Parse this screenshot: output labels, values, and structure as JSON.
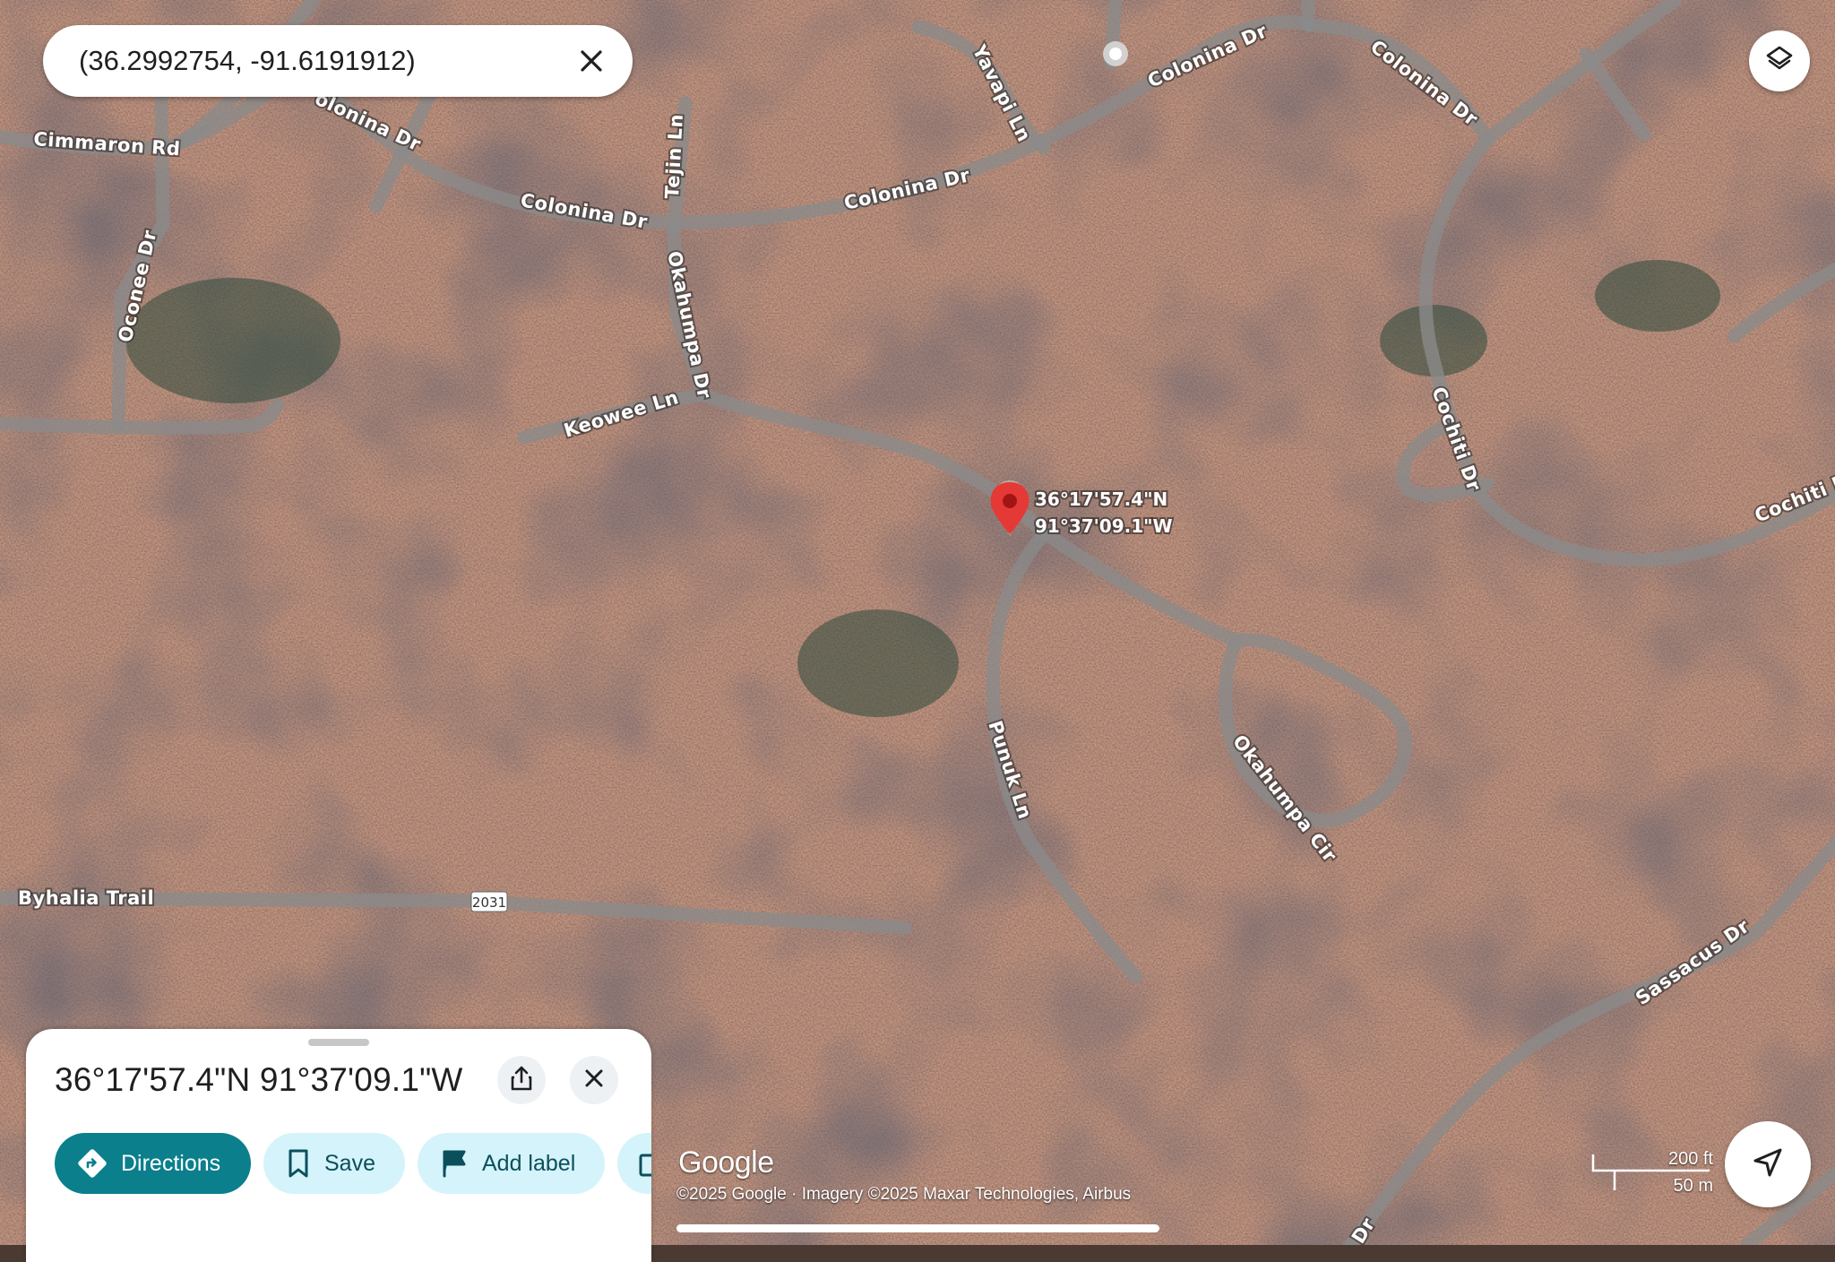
{
  "search": {
    "query": "(36.2992754, -91.6191912)"
  },
  "pin": {
    "lat_label": "36°17'57.4\"N",
    "lng_label": "91°37'09.1\"W"
  },
  "roads": {
    "cimmaron": "Cimmaron Rd",
    "colonina_a": "olonina Dr",
    "colonina_b": "Colonina Dr",
    "colonina_c": "Colonina Dr",
    "colonina_d": "Colonina Dr",
    "colonina_e": "Colonina Dr",
    "yavapi": "Yavapi Ln",
    "tejin": "Tejin Ln",
    "okahumpa_dr": "Okahumpa Dr",
    "oconee": "Oconee Dr",
    "keowee": "Keowee Ln",
    "cochiti_a": "Cochiti Dr",
    "cochiti_b": "Cochiti D",
    "punuk": "Punuk Ln",
    "okahumpa_cir": "Okahumpa Cir",
    "byhalia": "Byhalia Trail",
    "route_shield": "2031",
    "sassacus": "Sassacus Dr",
    "bottom_dr": "Dr"
  },
  "sheet": {
    "title": "36°17'57.4\"N 91°37'09.1\"W",
    "actions": {
      "directions": "Directions",
      "save": "Save",
      "add_label": "Add label"
    }
  },
  "attribution": {
    "logo": "Google",
    "text": "©2025 Google · Imagery ©2025 Maxar Technologies, Airbus"
  },
  "scale": {
    "imperial": "200 ft",
    "metric": "50 m"
  },
  "colors": {
    "pin": "#e53935",
    "accent": "#0b7f8c",
    "chip_bg": "#d5f3fa"
  },
  "icons": [
    "close-icon",
    "layers-icon",
    "share-icon",
    "directions-icon",
    "bookmark-icon",
    "flag-icon",
    "navigation-arrow-icon"
  ]
}
